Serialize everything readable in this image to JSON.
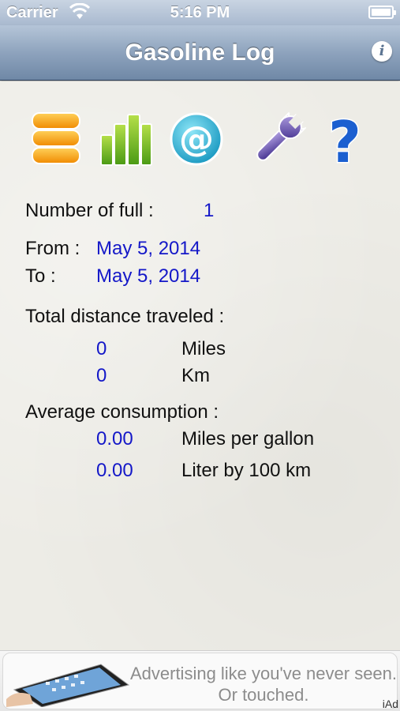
{
  "status_bar": {
    "carrier": "Carrier",
    "time": "5:16 PM"
  },
  "nav": {
    "title": "Gasoline Log",
    "info_label": "i"
  },
  "toolbar": [
    {
      "name": "records-icon"
    },
    {
      "name": "statistics-icon"
    },
    {
      "name": "email-icon"
    },
    {
      "name": "settings-icon"
    },
    {
      "name": "help-icon"
    }
  ],
  "stats": {
    "full_label": "Number of full :",
    "full_value": "1",
    "from_label": "From :",
    "from_value": "May 5, 2014",
    "to_label": "To :",
    "to_value": "May 5, 2014",
    "distance_label": "Total distance traveled :",
    "miles_value": "0",
    "miles_unit": "Miles",
    "km_value": "0",
    "km_unit": "Km",
    "consumption_label": "Average consumption :",
    "mpg_value": "0.00",
    "mpg_unit": "Miles per gallon",
    "l100_value": "0.00",
    "l100_unit": "Liter by 100 km"
  },
  "ad": {
    "line1": "Advertising like you've never seen.",
    "line2": "Or touched.",
    "badge": "iAd"
  },
  "colors": {
    "value_blue": "#1418c8",
    "nav_blue": "#7f97b4"
  }
}
